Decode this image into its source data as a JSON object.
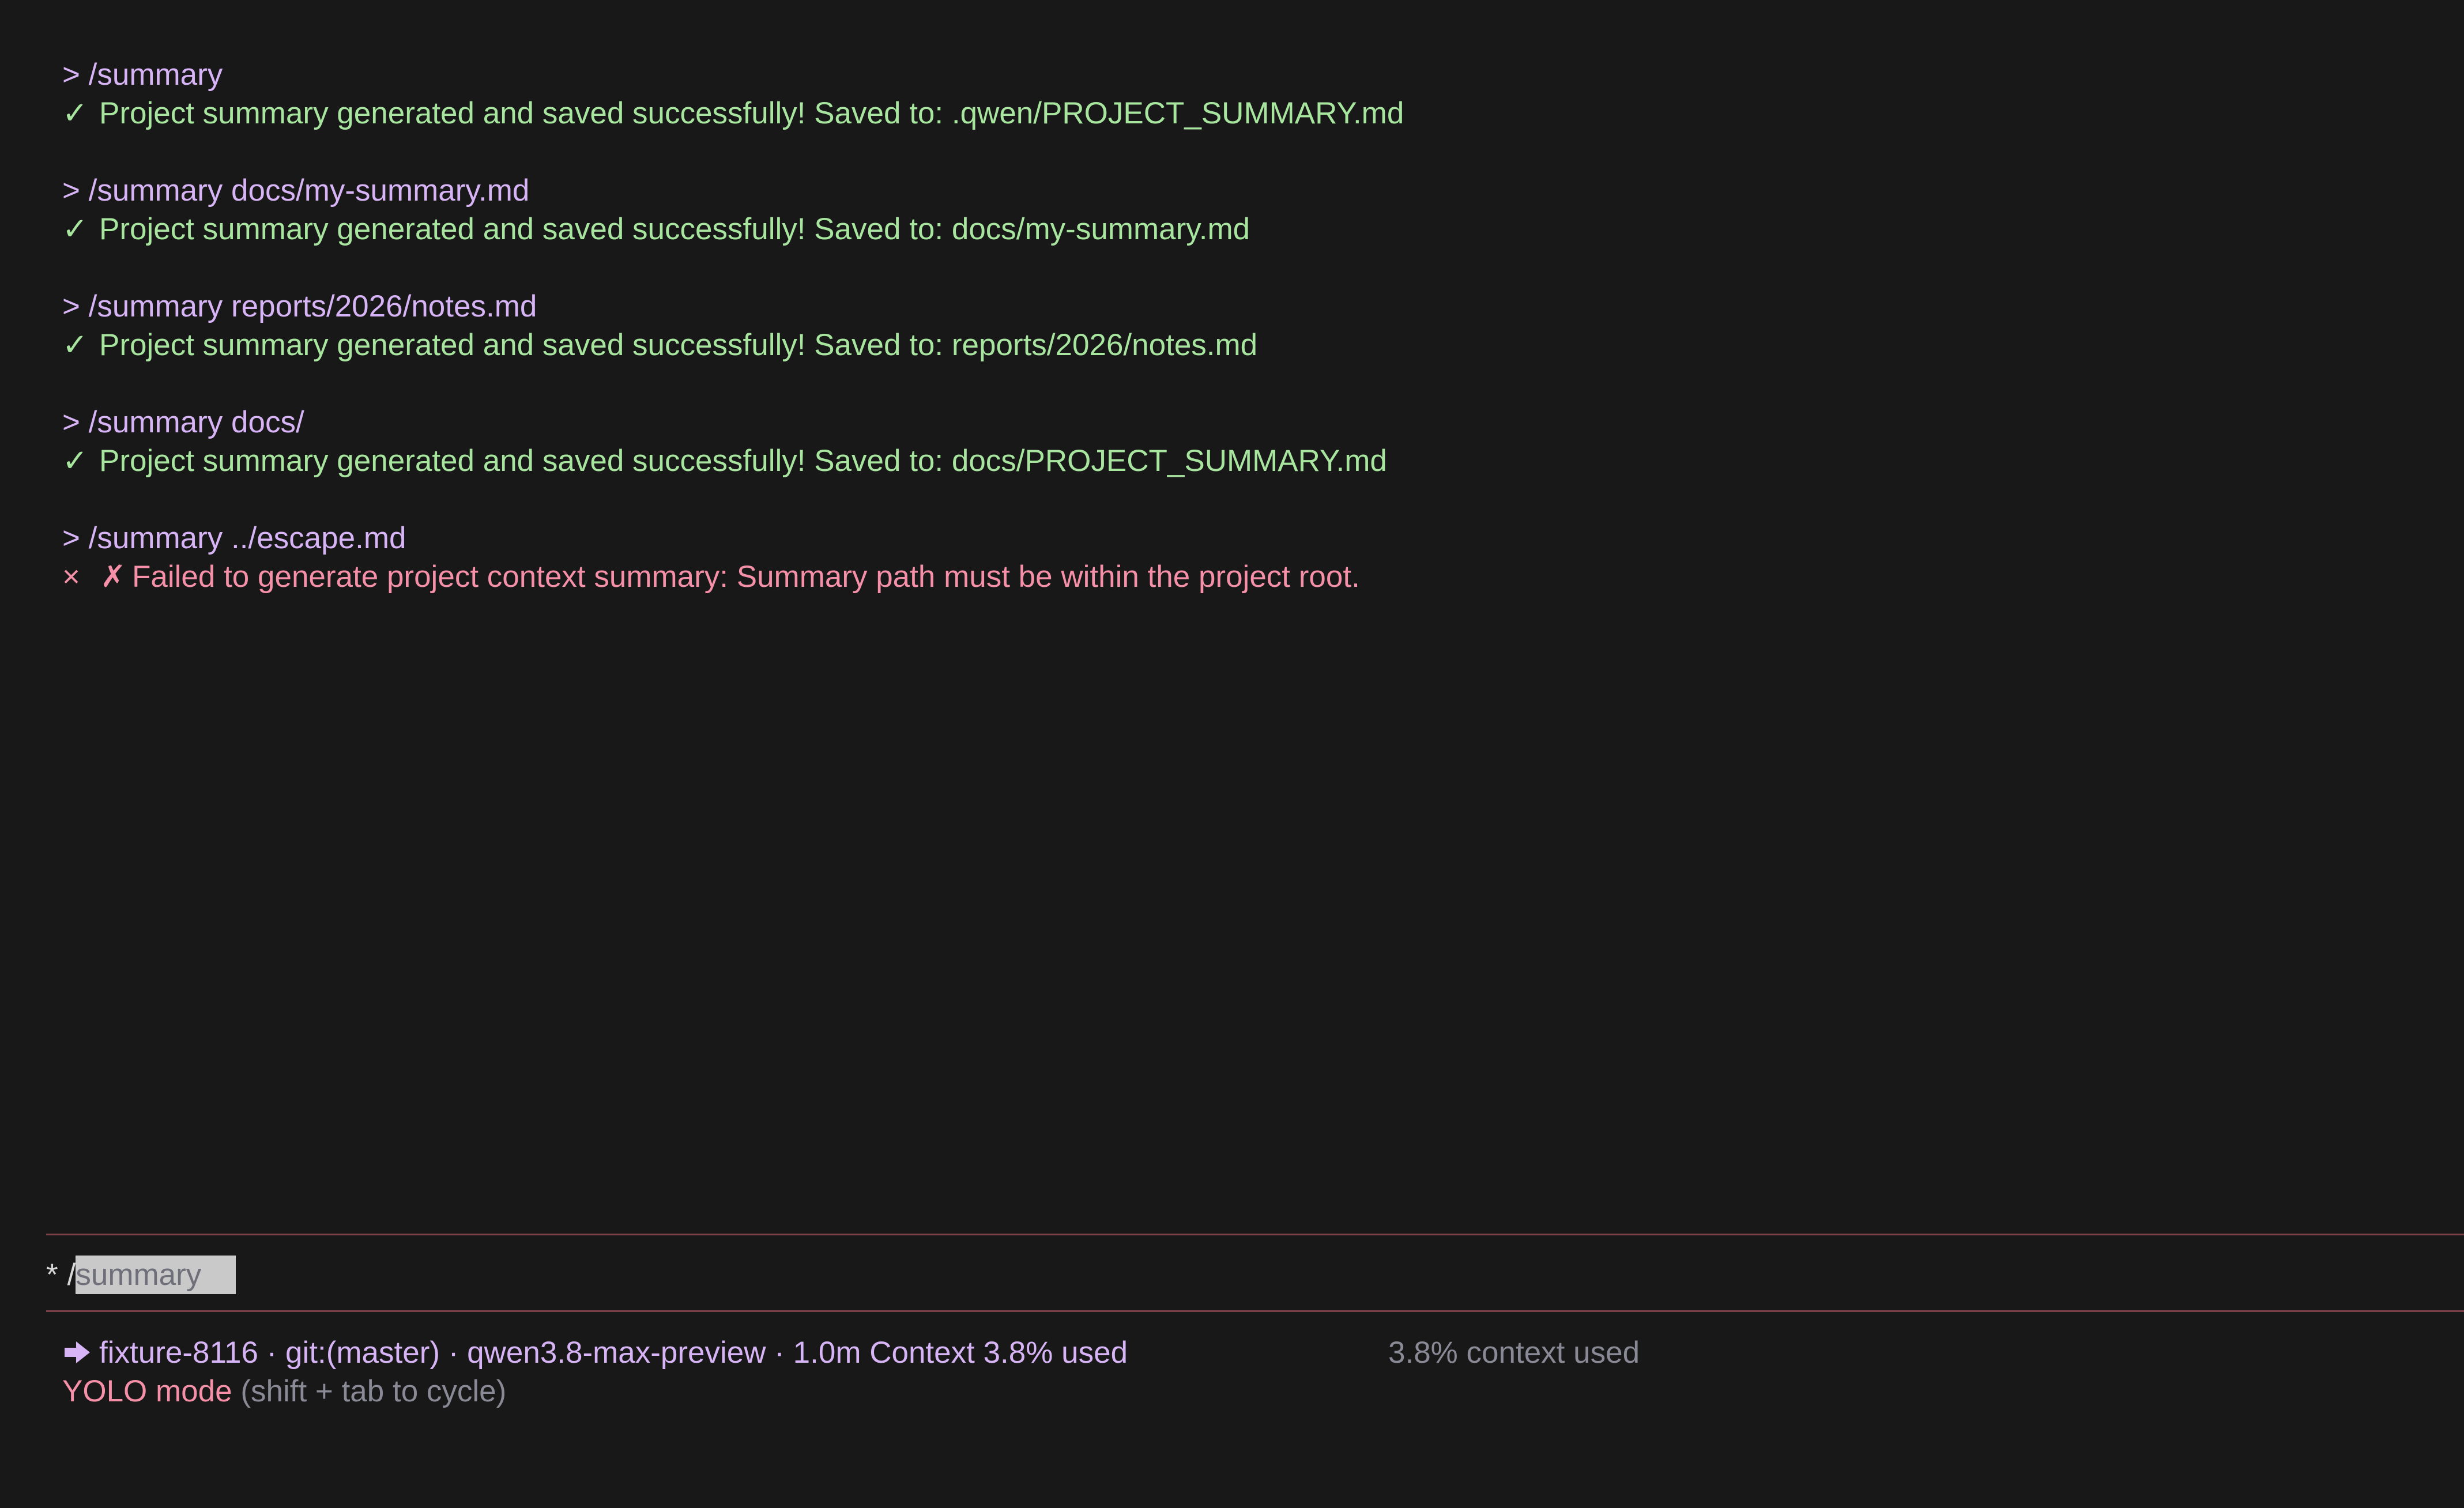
{
  "history": [
    {
      "command": "> /summary",
      "result_type": "ok",
      "result_glyph": "✓",
      "result_text": "Project summary generated and saved successfully! Saved to: .qwen/PROJECT_SUMMARY.md"
    },
    {
      "command": "> /summary docs/my-summary.md",
      "result_type": "ok",
      "result_glyph": "✓",
      "result_text": "Project summary generated and saved successfully! Saved to: docs/my-summary.md"
    },
    {
      "command": "> /summary reports/2026/notes.md",
      "result_type": "ok",
      "result_glyph": "✓",
      "result_text": "Project summary generated and saved successfully! Saved to: reports/2026/notes.md"
    },
    {
      "command": "> /summary docs/",
      "result_type": "ok",
      "result_glyph": "✓",
      "result_text": "Project summary generated and saved successfully! Saved to: docs/PROJECT_SUMMARY.md"
    },
    {
      "command": "> /summary ../escape.md",
      "result_type": "error",
      "result_glyph": "×",
      "result_glyph2": "✗",
      "result_text": "Failed to generate project context summary: Summary path must be within the project root."
    }
  ],
  "input": {
    "prompt_symbol": "*",
    "typed": "/",
    "suggestion": "summary"
  },
  "status": {
    "icon": "arrow-right-icon",
    "info": "fixture-8116 · git:(master) · qwen3.8-max-preview · 1.0m Context 3.8% used",
    "context_right": "3.8% context used",
    "mode": "YOLO mode",
    "mode_hint": "(shift + tab to cycle)"
  },
  "colors": {
    "background": "#181818",
    "command": "#d7b4f5",
    "success": "#a8e6a0",
    "error": "#f590a8",
    "divider": "#7d3f4a",
    "muted": "#8a8a96"
  }
}
